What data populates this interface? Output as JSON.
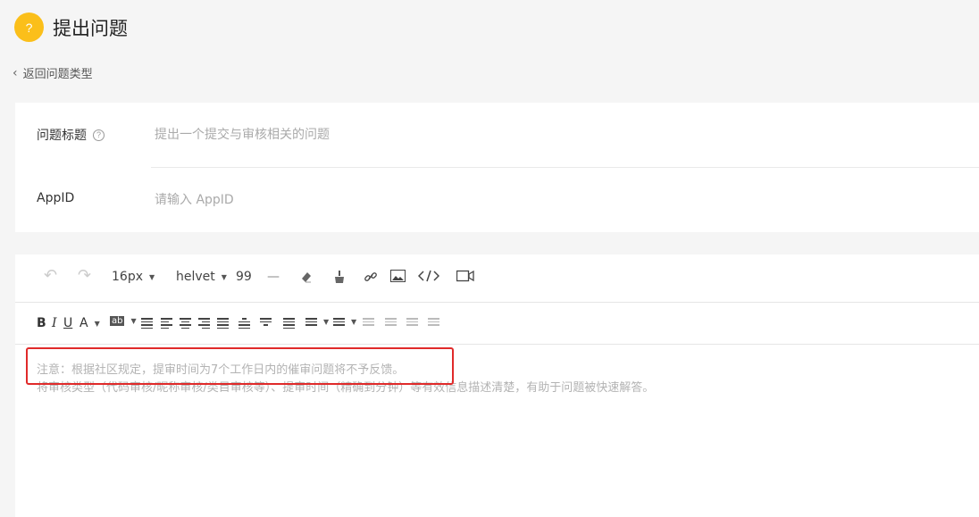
{
  "page": {
    "title": "提出问题",
    "back_label": "返回问题类型"
  },
  "form": {
    "title_label": "问题标题",
    "title_placeholder": "提出一个提交与审核相关的问题",
    "appid_label": "AppID",
    "appid_placeholder": "请输入 AppID"
  },
  "toolbar": {
    "font_size": "16px",
    "font_family": "helvet",
    "quote_label": "99",
    "hr_label": "—",
    "bold": "B",
    "italic": "I",
    "underline": "U",
    "font_color": "A",
    "bg_color": "ab"
  },
  "editor": {
    "notice": "注意：根据社区规定，提审时间为7个工作日内的催审问题将不予反馈。",
    "hint": "将审核类型（代码审核/昵称审核/类目审核等）、提审时间（精确到分钟）等有效信息描述清楚，有助于问题被快速解答。"
  },
  "colors": {
    "accent": "#fbbf1a",
    "highlight_border": "#e02a2a"
  },
  "icons": [
    "question-icon",
    "chevron-left-icon",
    "help-icon",
    "undo-icon",
    "redo-icon",
    "eraser-icon",
    "brush-icon",
    "link-icon",
    "image-icon",
    "code-icon",
    "video-icon"
  ]
}
